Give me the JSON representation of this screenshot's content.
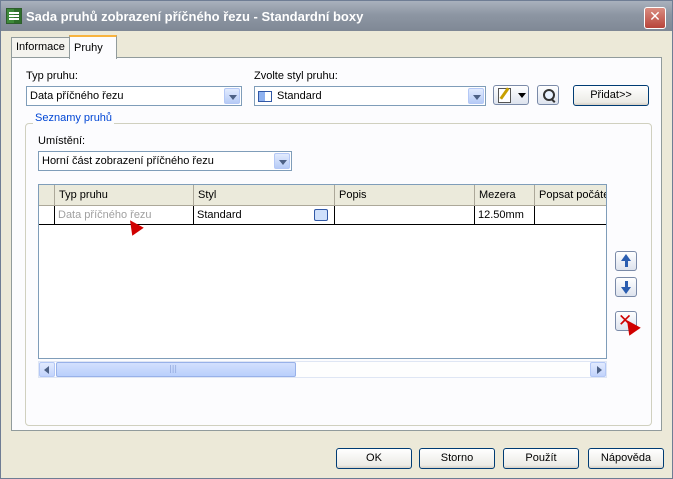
{
  "window": {
    "title": "Sada pruhů zobrazení příčného řezu - Standardní boxy",
    "close_glyph": "✕"
  },
  "tabs": [
    {
      "label": "Informace",
      "active": false
    },
    {
      "label": "Pruhy",
      "active": true
    }
  ],
  "band_type": {
    "label": "Typ pruhu:",
    "value": "Data příčného řezu"
  },
  "band_style": {
    "label": "Zvolte styl pruhu:",
    "value": "Standard"
  },
  "add_button": {
    "label": "Přidat>>"
  },
  "band_lists": {
    "group_label": "Seznamy pruhů",
    "location_label": "Umístění:",
    "location_value": "Horní část zobrazení příčného řezu"
  },
  "grid": {
    "columns": [
      "Typ pruhu",
      "Styl",
      "Popis",
      "Mezera",
      "Popsat počátek"
    ],
    "rows": [
      {
        "type": "Data příčného řezu",
        "style": "Standard",
        "description": "",
        "gap": "12.50mm",
        "label_start": ""
      }
    ]
  },
  "footer": {
    "ok": "OK",
    "cancel": "Storno",
    "apply": "Použít",
    "help": "Nápověda"
  },
  "colors": {
    "titlebar": "#8d96a3",
    "group_label": "#0046d5",
    "delete_red": "#d00000"
  }
}
